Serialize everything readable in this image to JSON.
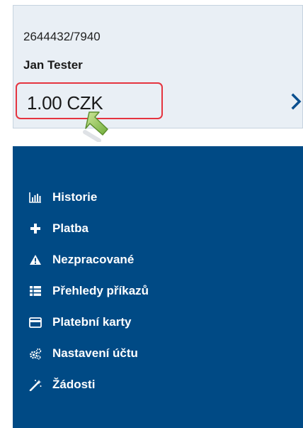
{
  "account": {
    "number": "2644432/7940",
    "holder": "Jan Tester",
    "balance": "1.00 CZK"
  },
  "icons": {
    "chevron": "chevron-right-icon",
    "cursor": "cursor-arrow-icon"
  },
  "colors": {
    "card_bg": "#e9eff5",
    "nav_bg": "#004a85",
    "highlight": "#e5343f",
    "chevron": "#0a4f8f"
  },
  "nav": {
    "items": [
      {
        "label": "Historie",
        "icon": "chart-bars-icon"
      },
      {
        "label": "Platba",
        "icon": "plus-icon"
      },
      {
        "label": "Nezpracované",
        "icon": "warning-icon"
      },
      {
        "label": "Přehledy příkazů",
        "icon": "list-icon"
      },
      {
        "label": "Platební karty",
        "icon": "credit-card-icon"
      },
      {
        "label": "Nastavení účtu",
        "icon": "gears-icon"
      },
      {
        "label": "Žádosti",
        "icon": "magic-wand-icon"
      }
    ]
  }
}
